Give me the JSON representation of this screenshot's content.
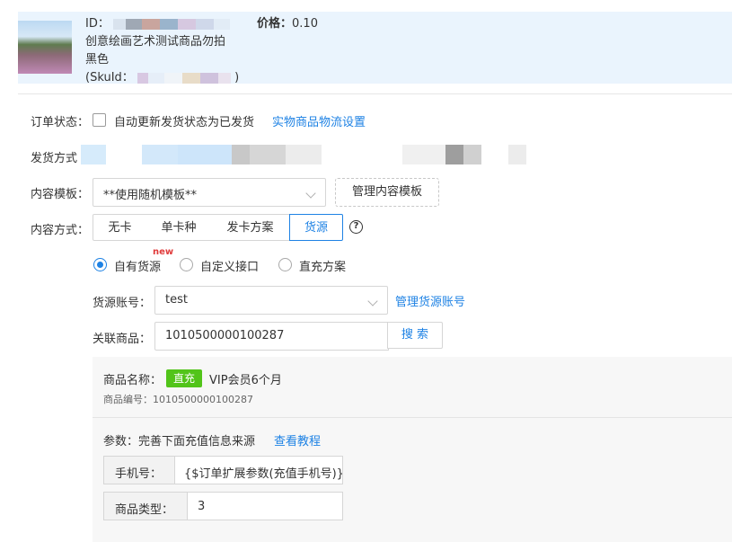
{
  "product": {
    "id_label": "ID：",
    "price_label": "价格：",
    "price_value": "0.10",
    "name": "创意绘画艺术测试商品勿拍",
    "color": "黑色",
    "skuid_prefix": "(SkuId：",
    "skuid_suffix": ")"
  },
  "order_status": {
    "label": "订单状态：",
    "auto_update_label": "自动更新发货状态为已发货",
    "logistics_link": "实物商品物流设置"
  },
  "ship_method": {
    "label": "发货方式"
  },
  "content_template": {
    "label": "内容模板：",
    "selected": "**使用随机模板**",
    "manage_button": "管理内容模板"
  },
  "content_method": {
    "label": "内容方式：",
    "options": [
      "无卡",
      "单卡种",
      "发卡方案",
      "货源"
    ],
    "active_index": 3,
    "help_icon": "?"
  },
  "source_type": {
    "options": [
      "自有货源",
      "自定义接口",
      "直充方案"
    ],
    "selected_index": 0,
    "new_badge": "new"
  },
  "source_account": {
    "label": "货源账号：",
    "selected": "test",
    "manage_link": "管理货源账号"
  },
  "related_product": {
    "label": "关联商品：",
    "value": "1010500000100287",
    "search_button": "搜 索"
  },
  "product_info": {
    "name_label": "商品名称：",
    "tag": "直充",
    "name_value": "VIP会员6个月",
    "code_label": "商品编号：",
    "code_value": "1010500000100287"
  },
  "params": {
    "label": "参数：",
    "hint": "完善下面充值信息来源",
    "tutorial_link": "查看教程",
    "phone_label": "手机号：",
    "phone_value": "{$订单扩展参数(充值手机号)}",
    "type_label": "商品类型：",
    "type_value": "3"
  },
  "colors": {
    "accent": "#1e82e4",
    "tag_green": "#52c41a",
    "card_bg": "#eaf4fd"
  }
}
